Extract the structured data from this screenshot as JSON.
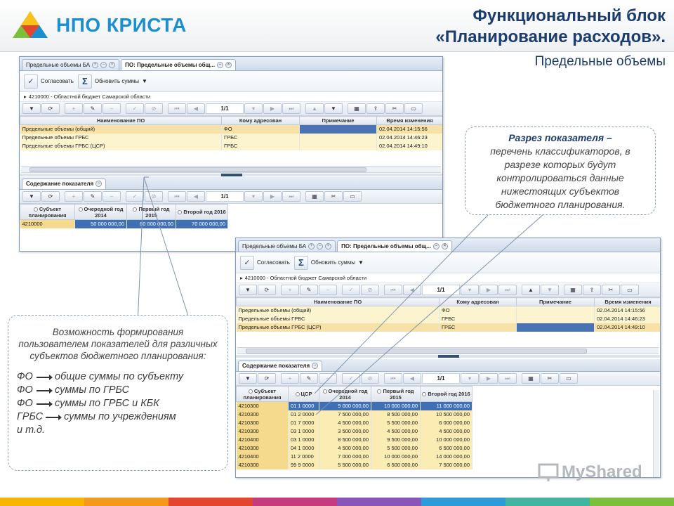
{
  "brand": {
    "logo_text": "НПО КРИСТА",
    "colors": {
      "blue": "#1b8fd0",
      "orange": "#f39a1e",
      "green": "#7cbf3a",
      "red": "#e2462e"
    }
  },
  "slide": {
    "title_line1": "Функциональный блок",
    "title_line2": "«Планирование расходов».",
    "subtitle": "Предельные объемы"
  },
  "window1": {
    "tabs": [
      {
        "label": "Предельные объемы БА"
      },
      {
        "label": "ПО: Предельные объемы общ..."
      }
    ],
    "ribbon": {
      "approve": "Согласовать",
      "refresh": "Обновить суммы"
    },
    "breadcrumb": "4210000 - Областной бюджет Самарской области",
    "pager": "1/1",
    "table": {
      "headers": [
        "Наименование ПО",
        "Кому адресован",
        "Примечание",
        "Время изменения"
      ],
      "rows": [
        [
          "Предельные объемы (общий)",
          "ФО",
          "",
          "02.04.2014 14:15:56"
        ],
        [
          "Предельные объемы ГРБС",
          "ГРБС",
          "",
          "02.04.2014 14:46:23"
        ],
        [
          "Предельные объемы ГРБС (ЦСР)",
          "ГРБС",
          "",
          "02.04.2014 14:49:10"
        ]
      ]
    },
    "subtab": "Содержание показателя",
    "pager2": "1/1",
    "content": {
      "headers": [
        "Субъект планирования",
        "Очередной год 2014",
        "Первый год 2015",
        "Второй год 2016"
      ],
      "rows": [
        [
          "4210000",
          "50 000 000,00",
          "60 000 000,00",
          "70 000 000,00"
        ]
      ]
    }
  },
  "window2": {
    "tabs": [
      {
        "label": "Предельные объемы БА"
      },
      {
        "label": "ПО: Предельные объемы общ..."
      }
    ],
    "ribbon": {
      "approve": "Согласовать",
      "refresh": "Обновить суммы"
    },
    "breadcrumb": "4210000 - Областной бюджет Самарской области",
    "pager": "1/1",
    "table": {
      "headers": [
        "Наименование ПО",
        "Кому адресован",
        "Примечание",
        "Время изменения"
      ],
      "rows": [
        [
          "Предельные объемы (общий)",
          "ФО",
          "",
          "02.04.2014 14:15:56"
        ],
        [
          "Предельные объемы ГРБС",
          "ГРБС",
          "",
          "02.04.2014 14:46:23"
        ],
        [
          "Предельные объемы ГРБС (ЦСР)",
          "ГРБС",
          "",
          "02.04.2014 14:49:10"
        ]
      ]
    },
    "subtab": "Содержание показателя",
    "pager2": "1/1",
    "content": {
      "headers": [
        "Субъект планирования",
        "ЦСР",
        "Очередной год 2014",
        "Первый год 2015",
        "Второй год 2016"
      ],
      "rows": [
        [
          "4210300",
          "01 1 0000",
          "9 000 000,00",
          "10 000 000,00",
          "11 000 000,00"
        ],
        [
          "4210300",
          "01 2 0000",
          "7 500 000,00",
          "8 500 000,00",
          "10 500 000,00"
        ],
        [
          "4210300",
          "01 7 0000",
          "4 500 000,00",
          "5 500 000,00",
          "6 000 000,00"
        ],
        [
          "4210300",
          "03 1 0000",
          "3 500 000,00",
          "4 500 000,00",
          "4 500 000,00"
        ],
        [
          "4210400",
          "03 1 0000",
          "8 500 000,00",
          "9 500 000,00",
          "10 000 000,00"
        ],
        [
          "4210300",
          "04 1 0000",
          "4 500 000,00",
          "5 500 000,00",
          "6 500 000,00"
        ],
        [
          "4210400",
          "11 2 0000",
          "7 000 000,00",
          "10 000 000,00",
          "14 000 000,00"
        ],
        [
          "4210300",
          "99 9 0000",
          "5 500 000,00",
          "6 500 000,00",
          "7 500 000,00"
        ]
      ]
    }
  },
  "callout_slice": {
    "lead": "Разрез показателя –",
    "text": "перечень классификаторов, в разрезе которых будут контролироваться данные нижестоящих субъектов бюджетного планирования."
  },
  "callout_indicators": {
    "intro": "Возможность формирования пользователем показателей для различных субъектов бюджетного планирования:",
    "items": [
      {
        "abbr": "ФО",
        "text": "общие суммы по субъекту"
      },
      {
        "abbr": "ФО",
        "text": "суммы по ГРБС"
      },
      {
        "abbr": "ФО",
        "text": "суммы по ГРБС и КБК"
      },
      {
        "abbr": "ГРБС",
        "text": "суммы по учреждениям"
      }
    ],
    "tail": "и т.д."
  },
  "watermark": {
    "text": "MyShared"
  },
  "stripe_colors": [
    "#f7b500",
    "#f39a1e",
    "#e2462e",
    "#c73a7e",
    "#8a55b8",
    "#2d9bd8",
    "#42b5a0",
    "#7cbf3a"
  ]
}
